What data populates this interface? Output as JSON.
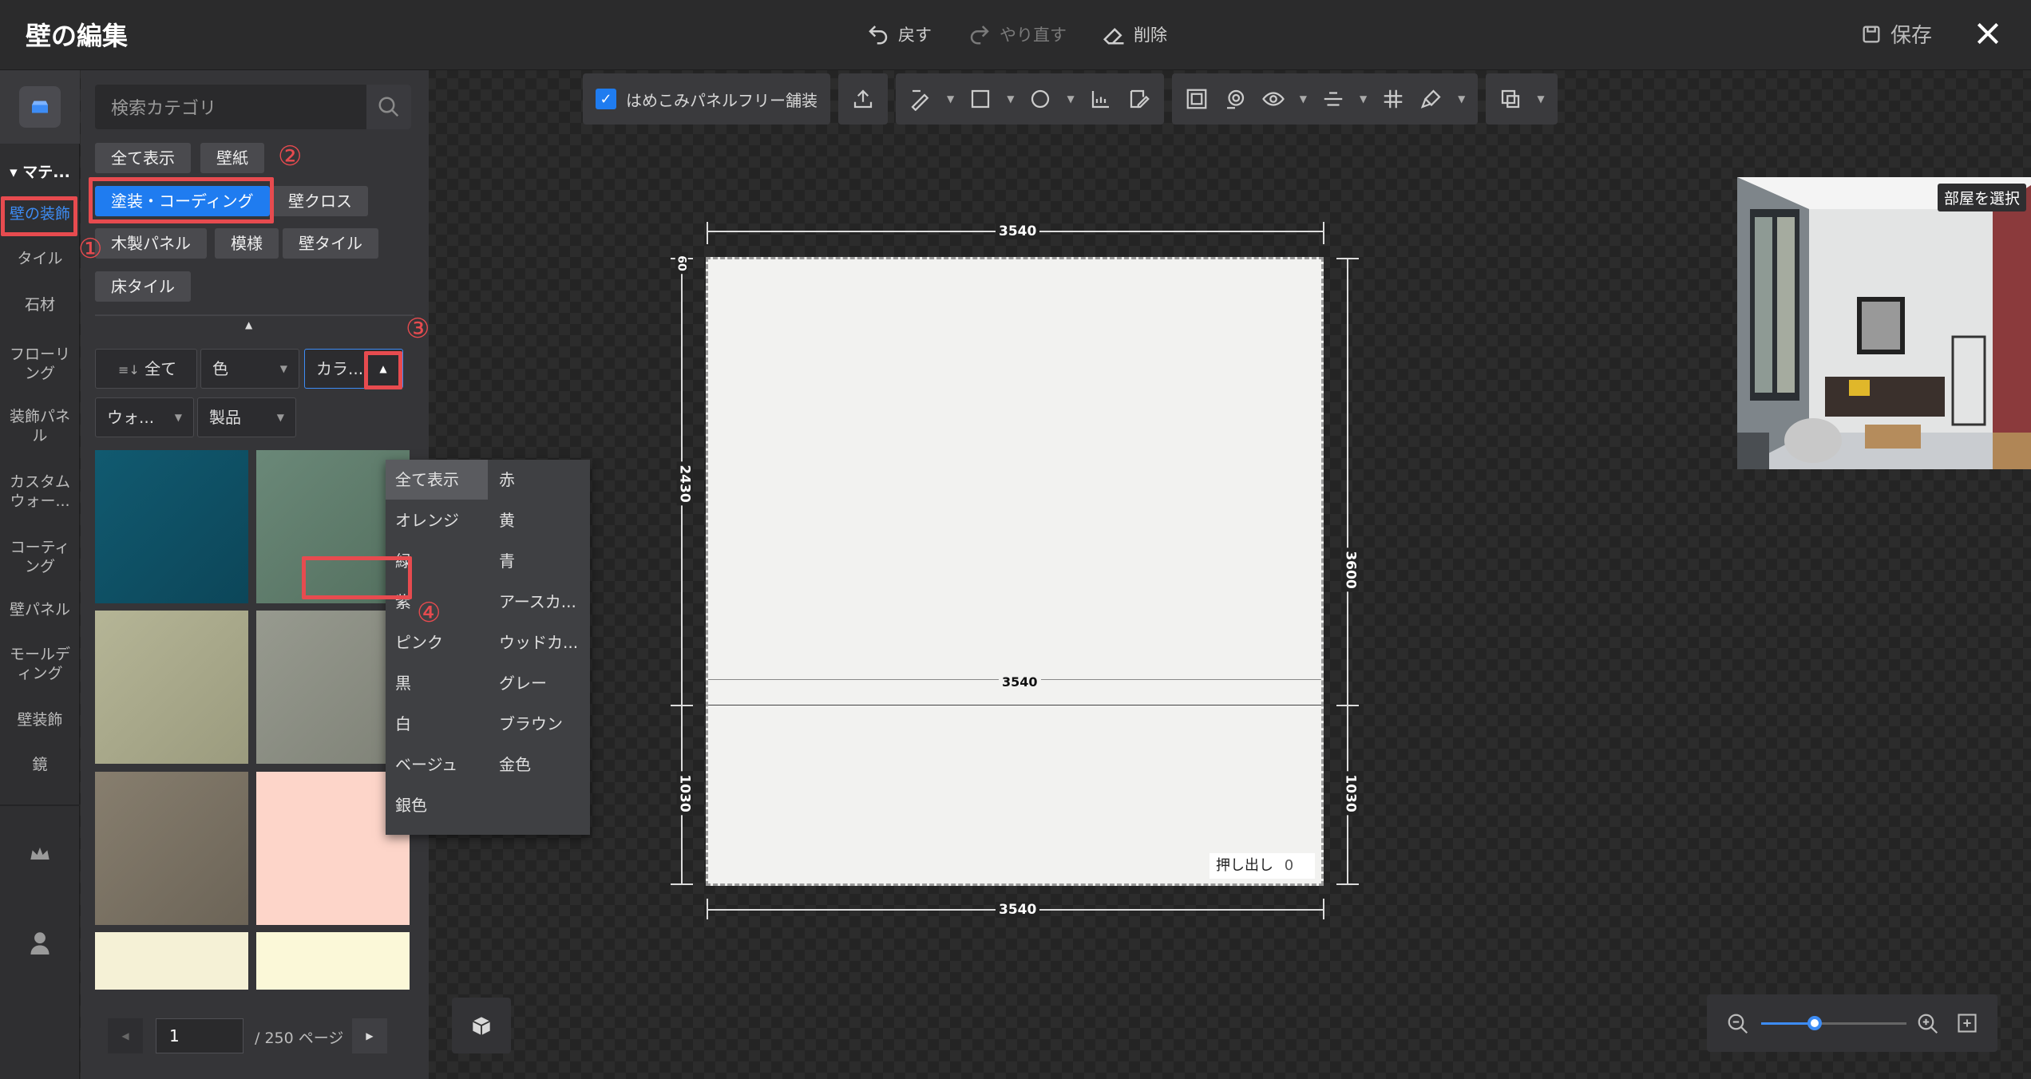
{
  "app": {
    "title": "壁の編集",
    "undo": "戻す",
    "redo": "やり直す",
    "delete": "削除",
    "save": "保存"
  },
  "rail": {
    "header": "マテ...",
    "items": [
      "壁の装飾",
      "タイル",
      "石材",
      "フローリング",
      "装飾パネル",
      "カスタムウォー...",
      "コーティング",
      "壁パネル",
      "モールディング",
      "壁装飾",
      "鏡"
    ]
  },
  "search": {
    "placeholder": "検索カテゴリ"
  },
  "tags": [
    "全て表示",
    "壁紙",
    "塗装・コーディング",
    "壁クロス",
    "木製パネル",
    "模様",
    "壁タイル",
    "床タイル"
  ],
  "filters": {
    "sort": "全て",
    "color": "色",
    "color_type": "カラ...",
    "wall": "ウォ...",
    "product": "製品"
  },
  "color_options": [
    "全て表示",
    "赤",
    "オレンジ",
    "黄",
    "緑",
    "青",
    "紫",
    "アースカ...",
    "ピンク",
    "ウッドカ...",
    "黒",
    "グレー",
    "白",
    "ブラウン",
    "ベージュ",
    "金色",
    "銀色"
  ],
  "pager": {
    "current": "1",
    "total": "/ 250 ページ"
  },
  "toolbar": {
    "checkbox_label": "はめこみパネルフリー舗装"
  },
  "dims": {
    "top": "3540",
    "bottom": "3540",
    "middle": "3540",
    "left_top": "2430",
    "left_bottom": "1030",
    "right": "3600",
    "right_bottom": "1030",
    "corner": "60"
  },
  "extrude": {
    "label": "押し出し",
    "value": "0"
  },
  "preview": {
    "select_room": "部屋を選択"
  },
  "annotations": [
    "①",
    "②",
    "③",
    "④"
  ],
  "tile_colors": [
    "#0e4f63",
    "#5e7a6c",
    "#a8a88a",
    "#8b8d82",
    "#7b7264",
    "#fdd5c9",
    "#f5f1d6",
    "#fbf8d8"
  ]
}
